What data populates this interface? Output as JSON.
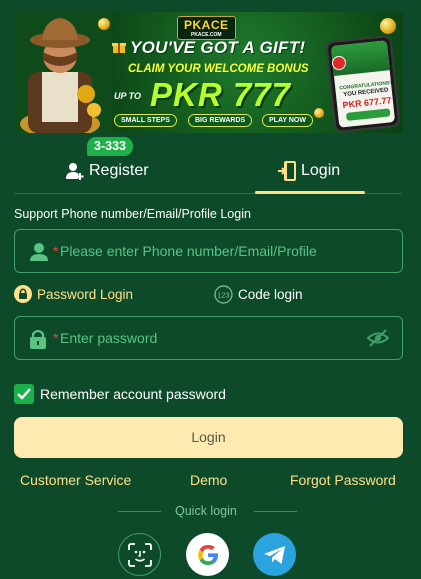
{
  "banner": {
    "logo_text": "PKACE",
    "logo_subtext": "PKACE.COM",
    "headline": "YOU'VE GOT A GIFT!",
    "claim": "CLAIM YOUR WELCOME BONUS",
    "up_to": "UP TO",
    "amount": "PKR 777",
    "pills": [
      "SMALL STEPS",
      "BIG REWARDS",
      "PLAY NOW"
    ],
    "phone_congrats": "CONGRATULATIONS!",
    "phone_received": "YOU RECEIVED",
    "phone_amount": "PKR 677.77"
  },
  "tabs": {
    "register_label": "Register",
    "register_badge": "3-333",
    "login_label": "Login"
  },
  "form": {
    "section_label": "Support Phone number/Email/Profile Login",
    "account_required_mark": "*",
    "account_placeholder": "Please enter Phone number/Email/Profile",
    "account_value": "",
    "password_required_mark": "*",
    "password_placeholder": "Enter password",
    "password_value": "",
    "mode_password": "Password Login",
    "mode_code": "Code login",
    "remember_label": "Remember account password",
    "remember_checked": true,
    "login_button": "Login"
  },
  "links": {
    "customer_service": "Customer Service",
    "demo": "Demo",
    "forgot_password": "Forgot Password"
  },
  "quick_login": {
    "label": "Quick login",
    "methods": [
      "face-id-icon",
      "google-icon",
      "telegram-icon"
    ]
  },
  "colors": {
    "background": "#0c4a2a",
    "accent_yellow": "#ffe08a",
    "field_border": "#3fa06a",
    "placeholder": "#59c483",
    "badge_green": "#1fb04a",
    "login_button_bg": "#fdeab1"
  }
}
